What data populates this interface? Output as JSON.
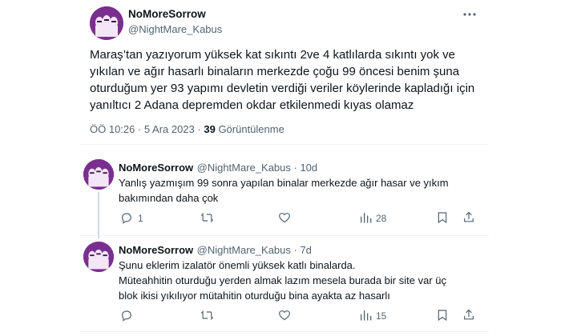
{
  "main_tweet": {
    "display_name": "NoMoreSorrow",
    "handle": "@NightMare_Kabus",
    "text_lines": [
      "Maraş’tan yazıyorum yüksek kat sıkıntı 2ve 4 katlılarda sıkıntı yok ve",
      "yıkılan ve ağır hasarlı binaların merkezde çoğu 99 öncesi benim şuna",
      "oturduğum yer 93 yapımı devletin verdiği veriler köylerinde kapladığı için",
      "yanıltıcı 2 Adana depremden okdar etkilenmedi kıyas olamaz"
    ],
    "timestamp": "ÖÖ 10:26 · 5 Ara 2023 · ",
    "views_count": "39",
    "views_label": " Görüntülenme"
  },
  "replies": [
    {
      "display_name": "NoMoreSorrow",
      "handle": "@NightMare_Kabus",
      "age": " · 10d",
      "text_lines": [
        "Yanlış yazmışım 99 sonra yapılan binalar merkezde ağır hasar ve yıkım",
        "bakımından daha çok"
      ],
      "reply_count": "1",
      "retweet_count": "",
      "like_count": "",
      "views_count": "28"
    },
    {
      "display_name": "NoMoreSorrow",
      "handle": "@NightMare_Kabus",
      "age": " · 7d",
      "text_lines": [
        "Şunu eklerim izalatör önemli yüksek katlı binalarda.",
        "Müteahhitin oturduğu yerden almak lazım mesela burada bir site var üç",
        "blok ikisi yıkılıyor mütahitin oturduğu bina ayakta az hasarlı"
      ],
      "reply_count": "",
      "retweet_count": "",
      "like_count": "",
      "views_count": "15"
    }
  ],
  "icons": {
    "more": "more-horizontal-icon",
    "reply": "reply-icon",
    "retweet": "retweet-icon",
    "like": "heart-icon",
    "views": "views-bar-chart-icon",
    "bookmark": "bookmark-icon"
  },
  "colors": {
    "text": "#0f1419",
    "muted": "#536471",
    "avatar_bg": "#7a2f8f",
    "divider": "#eff3f4"
  }
}
